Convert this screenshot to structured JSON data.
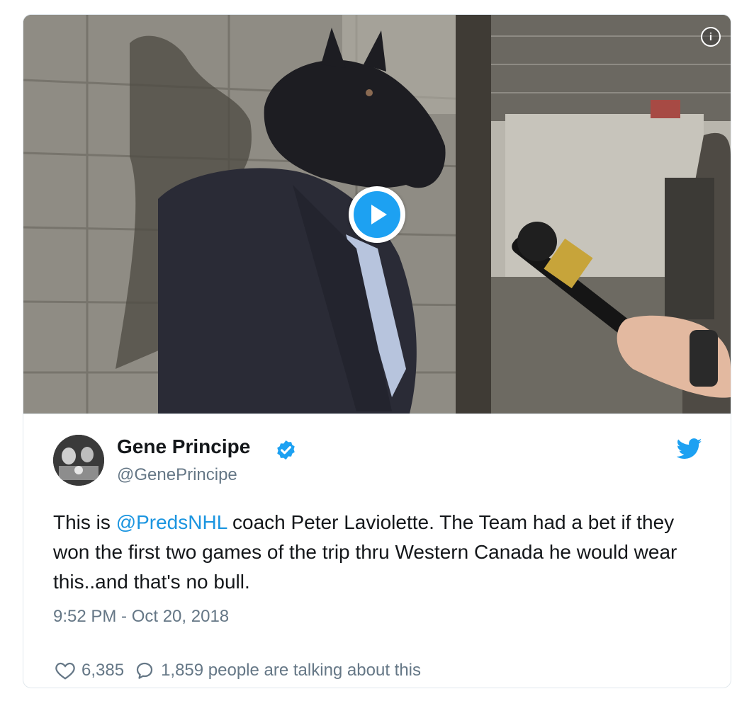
{
  "tweet": {
    "display_name": "Gene Principe",
    "handle": "@GenePrincipe",
    "verified": true,
    "text_before": "This is ",
    "mention": "@PredsNHL",
    "text_after": " coach Peter Laviolette. The Team had a bet if they won the first two games of the trip thru Western Canada he would wear this..and that's no bull.",
    "timestamp": "9:52 PM - Oct 20, 2018",
    "likes": "6,385",
    "conversation": "1,859 people are talking about this"
  },
  "media": {
    "type": "video",
    "play_icon": "play-icon",
    "info_icon": "info-icon"
  },
  "colors": {
    "accent": "#1da1f2",
    "link": "#1b95e0",
    "muted": "#657786",
    "text": "#14171a",
    "border": "#e1e8ed"
  },
  "icons": [
    "info-icon",
    "play-icon",
    "verified-badge-icon",
    "twitter-bird-icon",
    "heart-icon",
    "speech-bubble-icon"
  ]
}
